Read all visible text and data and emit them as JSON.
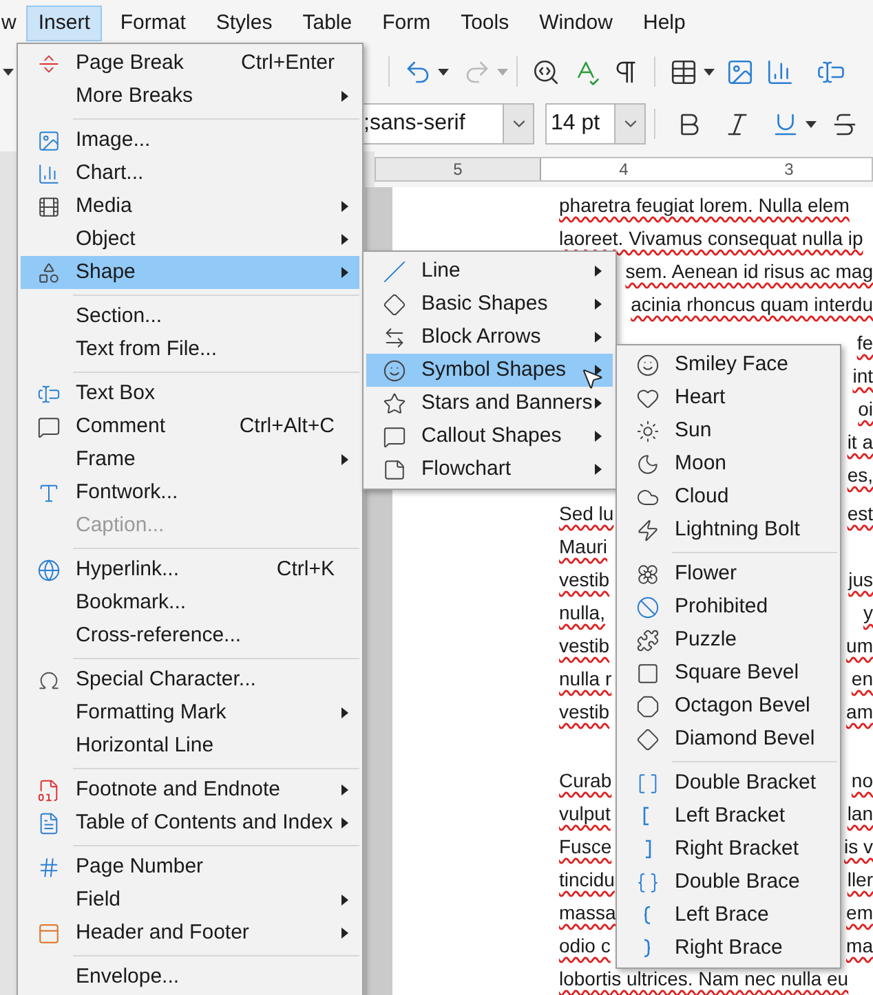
{
  "menubar": [
    {
      "label": "w",
      "selected": false
    },
    {
      "label": "Insert",
      "selected": true
    },
    {
      "label": "Format",
      "selected": false
    },
    {
      "label": "Styles",
      "selected": false
    },
    {
      "label": "Table",
      "selected": false
    },
    {
      "label": "Form",
      "selected": false
    },
    {
      "label": "Tools",
      "selected": false
    },
    {
      "label": "Window",
      "selected": false
    },
    {
      "label": "Help",
      "selected": false
    }
  ],
  "formatting_bar": {
    "font_name": {
      "value": ";sans-serif"
    },
    "font_size": {
      "value": "14 pt"
    }
  },
  "ruler": {
    "labels": [
      "5",
      "4",
      "3"
    ]
  },
  "document": {
    "paragraphs": [
      {
        "lines": [
          {
            "left": "pharetra feugiat lorem. Nulla elem"
          },
          {
            "left": "laoreet. Vivamus consequat nulla ip"
          },
          {
            "right": "sem. Aenean id risus ac mag"
          },
          {
            "right": "acinia rhoncus quam interdu"
          }
        ]
      },
      {
        "lines": [
          {
            "right": "fe"
          },
          {
            "right": "int"
          },
          {
            "right": "oi"
          },
          {
            "right": "it a"
          },
          {
            "right": "es,"
          }
        ]
      },
      {
        "lines": [
          {
            "left": "Sed lu",
            "right": "est"
          },
          {
            "left": "Mauri"
          },
          {
            "left": "vestib",
            "right": "jus"
          },
          {
            "left": "nulla,",
            "right": "y"
          },
          {
            "left": "vestib",
            "right": "um"
          },
          {
            "left": "nulla r",
            "right": "en"
          },
          {
            "left": "vestib",
            "right": "am"
          }
        ]
      },
      {
        "lines": [
          {
            "left": "Curab",
            "right": "no"
          },
          {
            "left": "vulput",
            "right": "lan"
          },
          {
            "left": "Fusce",
            "right": "is v"
          },
          {
            "left": "tincidu",
            "right": "ller"
          },
          {
            "left": "massa",
            "right": "em"
          },
          {
            "left": "odio c",
            "right": "ma"
          },
          {
            "left": "lobortis ultrices. Nam nec nulla eu"
          }
        ]
      }
    ]
  },
  "insert_menu": {
    "items": [
      {
        "kind": "item",
        "label": "Page Break",
        "shortcut": "Ctrl+Enter",
        "submenu": false,
        "disabled": false,
        "selected": false
      },
      {
        "kind": "item",
        "label": "More Breaks",
        "submenu": true,
        "disabled": false,
        "selected": false
      },
      {
        "kind": "separator"
      },
      {
        "kind": "item",
        "label": "Image...",
        "submenu": false,
        "disabled": false,
        "selected": false
      },
      {
        "kind": "item",
        "label": "Chart...",
        "submenu": false,
        "disabled": false,
        "selected": false
      },
      {
        "kind": "item",
        "label": "Media",
        "submenu": true,
        "disabled": false,
        "selected": false
      },
      {
        "kind": "item",
        "label": "Object",
        "submenu": true,
        "disabled": false,
        "selected": false
      },
      {
        "kind": "item",
        "label": "Shape",
        "submenu": true,
        "disabled": false,
        "selected": true
      },
      {
        "kind": "separator"
      },
      {
        "kind": "item",
        "label": "Section...",
        "submenu": false,
        "disabled": false,
        "selected": false
      },
      {
        "kind": "item",
        "label": "Text from File...",
        "submenu": false,
        "disabled": false,
        "selected": false
      },
      {
        "kind": "separator"
      },
      {
        "kind": "item",
        "label": "Text Box",
        "submenu": false,
        "disabled": false,
        "selected": false
      },
      {
        "kind": "item",
        "label": "Comment",
        "shortcut": "Ctrl+Alt+C",
        "submenu": false,
        "disabled": false,
        "selected": false
      },
      {
        "kind": "item",
        "label": "Frame",
        "submenu": true,
        "disabled": false,
        "selected": false
      },
      {
        "kind": "item",
        "label": "Fontwork...",
        "submenu": false,
        "disabled": false,
        "selected": false
      },
      {
        "kind": "item",
        "label": "Caption...",
        "submenu": false,
        "disabled": true,
        "selected": false
      },
      {
        "kind": "separator"
      },
      {
        "kind": "item",
        "label": "Hyperlink...",
        "shortcut": "Ctrl+K",
        "submenu": false,
        "disabled": false,
        "selected": false
      },
      {
        "kind": "item",
        "label": "Bookmark...",
        "submenu": false,
        "disabled": false,
        "selected": false
      },
      {
        "kind": "item",
        "label": "Cross-reference...",
        "submenu": false,
        "disabled": false,
        "selected": false
      },
      {
        "kind": "separator"
      },
      {
        "kind": "item",
        "label": "Special Character...",
        "submenu": false,
        "disabled": false,
        "selected": false
      },
      {
        "kind": "item",
        "label": "Formatting Mark",
        "submenu": true,
        "disabled": false,
        "selected": false
      },
      {
        "kind": "item",
        "label": "Horizontal Line",
        "submenu": false,
        "disabled": false,
        "selected": false
      },
      {
        "kind": "separator"
      },
      {
        "kind": "item",
        "label": "Footnote and Endnote",
        "submenu": true,
        "disabled": false,
        "selected": false
      },
      {
        "kind": "item",
        "label": "Table of Contents and Index",
        "submenu": true,
        "disabled": false,
        "selected": false
      },
      {
        "kind": "separator"
      },
      {
        "kind": "item",
        "label": "Page Number",
        "submenu": false,
        "disabled": false,
        "selected": false
      },
      {
        "kind": "item",
        "label": "Field",
        "submenu": true,
        "disabled": false,
        "selected": false
      },
      {
        "kind": "item",
        "label": "Header and Footer",
        "submenu": true,
        "disabled": false,
        "selected": false
      },
      {
        "kind": "separator"
      },
      {
        "kind": "item",
        "label": "Envelope...",
        "submenu": false,
        "disabled": false,
        "selected": false
      }
    ]
  },
  "shape_menu": {
    "items": [
      {
        "kind": "item",
        "label": "Line",
        "submenu": true,
        "selected": false
      },
      {
        "kind": "item",
        "label": "Basic Shapes",
        "submenu": true,
        "selected": false
      },
      {
        "kind": "item",
        "label": "Block Arrows",
        "submenu": true,
        "selected": false
      },
      {
        "kind": "item",
        "label": "Symbol Shapes",
        "submenu": true,
        "selected": true
      },
      {
        "kind": "item",
        "label": "Stars and Banners",
        "submenu": true,
        "selected": false
      },
      {
        "kind": "item",
        "label": "Callout Shapes",
        "submenu": true,
        "selected": false
      },
      {
        "kind": "item",
        "label": "Flowchart",
        "submenu": true,
        "selected": false
      }
    ]
  },
  "symbol_menu": {
    "items": [
      {
        "kind": "item",
        "label": "Smiley Face",
        "selected": false
      },
      {
        "kind": "item",
        "label": "Heart",
        "selected": false
      },
      {
        "kind": "item",
        "label": "Sun",
        "selected": false
      },
      {
        "kind": "item",
        "label": "Moon",
        "selected": false
      },
      {
        "kind": "item",
        "label": "Cloud",
        "selected": false
      },
      {
        "kind": "item",
        "label": "Lightning Bolt",
        "selected": false
      },
      {
        "kind": "separator"
      },
      {
        "kind": "item",
        "label": "Flower",
        "selected": false
      },
      {
        "kind": "item",
        "label": "Prohibited",
        "selected": false
      },
      {
        "kind": "item",
        "label": "Puzzle",
        "selected": false
      },
      {
        "kind": "item",
        "label": "Square Bevel",
        "selected": false
      },
      {
        "kind": "item",
        "label": "Octagon Bevel",
        "selected": false
      },
      {
        "kind": "item",
        "label": "Diamond Bevel",
        "selected": false
      },
      {
        "kind": "separator"
      },
      {
        "kind": "item",
        "label": "Double Bracket",
        "selected": false
      },
      {
        "kind": "item",
        "label": "Left Bracket",
        "selected": false
      },
      {
        "kind": "item",
        "label": "Right Bracket",
        "selected": false
      },
      {
        "kind": "item",
        "label": "Double Brace",
        "selected": false
      },
      {
        "kind": "item",
        "label": "Left Brace",
        "selected": false
      },
      {
        "kind": "item",
        "label": "Right Brace",
        "selected": false
      }
    ]
  }
}
